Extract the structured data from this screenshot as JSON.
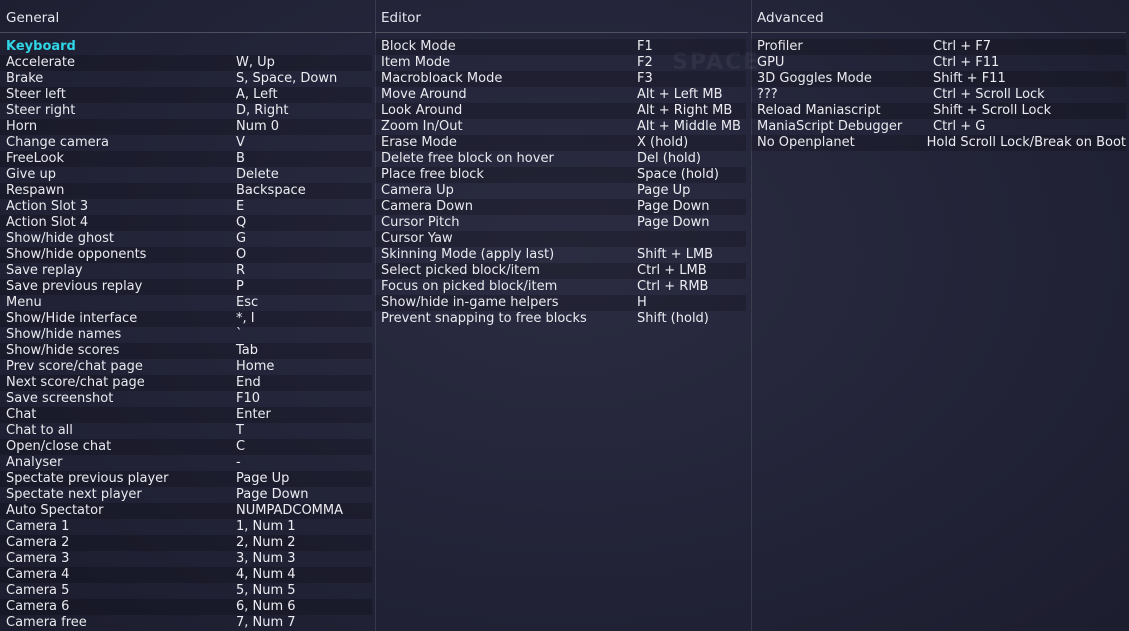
{
  "background_word": "SPACE",
  "columns": {
    "general": {
      "header": "General",
      "section_title": "Keyboard",
      "rows": [
        {
          "action": "Accelerate",
          "key": "W, Up"
        },
        {
          "action": "Brake",
          "key": "S, Space, Down"
        },
        {
          "action": "Steer left",
          "key": "A, Left"
        },
        {
          "action": "Steer right",
          "key": "D, Right"
        },
        {
          "action": "Horn",
          "key": "Num 0"
        },
        {
          "action": "Change camera",
          "key": "V"
        },
        {
          "action": "FreeLook",
          "key": "B"
        },
        {
          "action": "Give up",
          "key": "Delete"
        },
        {
          "action": "Respawn",
          "key": "Backspace"
        },
        {
          "action": "Action Slot 3",
          "key": "E"
        },
        {
          "action": "Action Slot 4",
          "key": "Q"
        },
        {
          "action": "Show/hide ghost",
          "key": "G"
        },
        {
          "action": "Show/hide opponents",
          "key": "O"
        },
        {
          "action": "Save replay",
          "key": "R"
        },
        {
          "action": "Save previous replay",
          "key": "P"
        },
        {
          "action": "Menu",
          "key": "Esc"
        },
        {
          "action": "Show/Hide interface",
          "key": "*, I"
        },
        {
          "action": "Show/hide names",
          "key": "`"
        },
        {
          "action": "Show/hide scores",
          "key": "Tab"
        },
        {
          "action": "Prev score/chat page",
          "key": "Home"
        },
        {
          "action": "Next score/chat page",
          "key": "End"
        },
        {
          "action": "Save screenshot",
          "key": "F10"
        },
        {
          "action": "Chat",
          "key": "Enter"
        },
        {
          "action": "Chat to all",
          "key": "T"
        },
        {
          "action": "Open/close chat",
          "key": "C"
        },
        {
          "action": "Analyser",
          "key": "-"
        },
        {
          "action": "Spectate previous player",
          "key": "Page Up"
        },
        {
          "action": "Spectate next player",
          "key": "Page Down"
        },
        {
          "action": "Auto Spectator",
          "key": "NUMPADCOMMA"
        },
        {
          "action": "Camera 1",
          "key": "1, Num 1"
        },
        {
          "action": "Camera 2",
          "key": "2, Num 2"
        },
        {
          "action": "Camera 3",
          "key": "3, Num 3"
        },
        {
          "action": "Camera 4",
          "key": "4, Num 4"
        },
        {
          "action": "Camera 5",
          "key": "5, Num 5"
        },
        {
          "action": "Camera 6",
          "key": "6, Num 6"
        },
        {
          "action": "Camera free",
          "key": "7, Num 7"
        }
      ]
    },
    "editor": {
      "header": "Editor",
      "rows": [
        {
          "action": "Block Mode",
          "key": "F1"
        },
        {
          "action": "Item Mode",
          "key": "F2"
        },
        {
          "action": "Macrobloack Mode",
          "key": "F3"
        },
        {
          "action": "Move Around",
          "key": "Alt + Left MB"
        },
        {
          "action": "Look Around",
          "key": "Alt + Right MB"
        },
        {
          "action": "Zoom In/Out",
          "key": "Alt + Middle MB"
        },
        {
          "action": "Erase Mode",
          "key": "X (hold)"
        },
        {
          "action": "Delete free block on hover",
          "key": "Del (hold)"
        },
        {
          "action": "Place free block",
          "key": "Space (hold)"
        },
        {
          "action": "Camera Up",
          "key": "Page Up"
        },
        {
          "action": "Camera Down",
          "key": "Page Down"
        },
        {
          "action": "Cursor Pitch",
          "key": "Page Down"
        },
        {
          "action": "Cursor Yaw",
          "key": ""
        },
        {
          "action": "Skinning Mode (apply last)",
          "key": "Shift + LMB"
        },
        {
          "action": "Select picked block/item",
          "key": "Ctrl + LMB"
        },
        {
          "action": "Focus on picked block/item",
          "key": "Ctrl + RMB"
        },
        {
          "action": "Show/hide in-game helpers",
          "key": "H"
        },
        {
          "action": "Prevent snapping to free blocks",
          "key": "Shift (hold)"
        }
      ]
    },
    "advanced": {
      "header": "Advanced",
      "rows": [
        {
          "action": "Profiler",
          "key": "Ctrl + F7"
        },
        {
          "action": "GPU",
          "key": "Ctrl + F11"
        },
        {
          "action": "3D Goggles Mode",
          "key": "Shift + F11"
        },
        {
          "action": "???",
          "key": "Ctrl + Scroll Lock"
        },
        {
          "action": "Reload Maniascript",
          "key": "Shift + Scroll Lock"
        },
        {
          "action": "ManiaScript Debugger",
          "key": "Ctrl + G"
        },
        {
          "action": "No Openplanet",
          "key": "Hold Scroll Lock/Break on Boot"
        }
      ]
    }
  }
}
